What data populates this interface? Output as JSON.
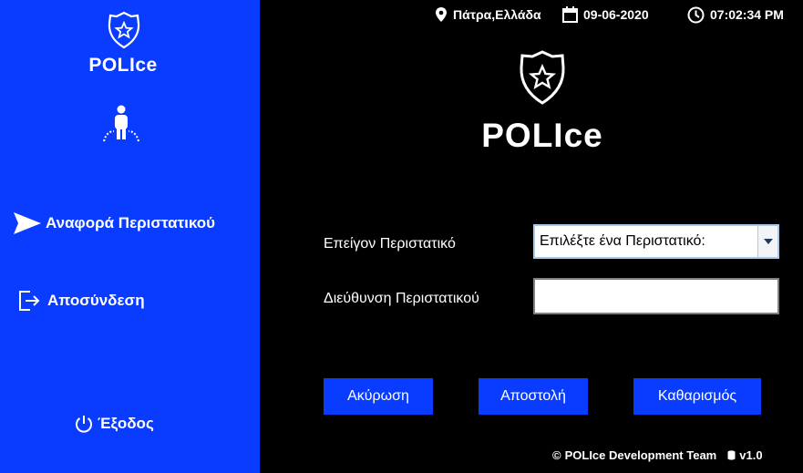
{
  "sidebar": {
    "app_name": "POLIce",
    "items": {
      "report": "Αναφορά Περιστατικού",
      "logout": "Αποσύνδεση",
      "exit": "Έξοδος"
    }
  },
  "header": {
    "location": "Πάτρα,Ελλάδα",
    "date": "09-06-2020",
    "time": "07:02:34 PM"
  },
  "main": {
    "title": "POLIce"
  },
  "form": {
    "incident_label": "Επείγον Περιστατικό",
    "incident_selected": "Επιλέξτε ένα Περιστατικό:",
    "address_label": "Διεύθυνση Περιστατικού",
    "address_value": ""
  },
  "buttons": {
    "cancel": "Ακύρωση",
    "send": "Αποστολή",
    "clear": "Καθαρισμός"
  },
  "footer": {
    "copyright_symbol": "©",
    "team": "POLIce Development Team",
    "version": "v1.0"
  },
  "colors": {
    "sidebar": "#0a3cff",
    "background": "#000000",
    "button": "#0a3cff"
  }
}
